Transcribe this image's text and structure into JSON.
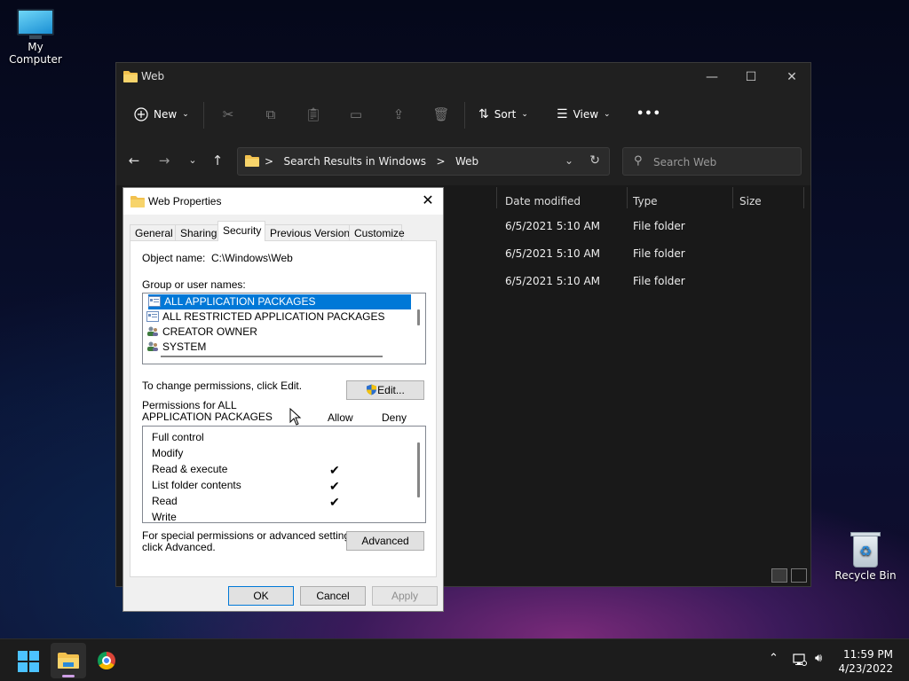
{
  "desktop": {
    "my_computer": "My Computer",
    "recycle_bin": "Recycle Bin"
  },
  "explorer": {
    "title": "Web",
    "toolbar": {
      "new_label": "New",
      "sort_label": "Sort",
      "view_label": "View",
      "more_label": "•••"
    },
    "address": {
      "part1": "Search Results in Windows",
      "part2": "Web",
      "separator": ">"
    },
    "search": {
      "placeholder": "Search Web"
    },
    "columns": {
      "date_modified": "Date modified",
      "type": "Type",
      "size": "Size"
    },
    "rows": [
      {
        "date": "6/5/2021 5:10 AM",
        "type": "File folder"
      },
      {
        "date": "6/5/2021 5:10 AM",
        "type": "File folder"
      },
      {
        "date": "6/5/2021 5:10 AM",
        "type": "File folder"
      }
    ]
  },
  "dialog": {
    "title": "Web Properties",
    "close": "✕",
    "tabs": [
      "General",
      "Sharing",
      "Security",
      "Previous Versions",
      "Customize"
    ],
    "active_tab": "Security",
    "object_name_label": "Object name:",
    "object_name_value": "C:\\Windows\\Web",
    "group_label": "Group or user names:",
    "groups": [
      "ALL APPLICATION PACKAGES",
      "ALL RESTRICTED APPLICATION PACKAGES",
      "CREATOR OWNER",
      "SYSTEM"
    ],
    "selected_group": "ALL APPLICATION PACKAGES",
    "change_text": "To change permissions, click Edit.",
    "edit_button": "Edit...",
    "permissions_label_line1": "Permissions for ALL",
    "permissions_label_line2": "APPLICATION PACKAGES",
    "allow_label": "Allow",
    "deny_label": "Deny",
    "permissions": [
      {
        "name": "Full control",
        "allow": false
      },
      {
        "name": "Modify",
        "allow": false
      },
      {
        "name": "Read & execute",
        "allow": true
      },
      {
        "name": "List folder contents",
        "allow": true
      },
      {
        "name": "Read",
        "allow": true
      },
      {
        "name": "Write",
        "allow": false
      }
    ],
    "check_glyph": "✔",
    "special_text_line1": "For special permissions or advanced settings,",
    "special_text_line2": "click Advanced.",
    "advanced_button": "Advanced",
    "ok_button": "OK",
    "cancel_button": "Cancel",
    "apply_button": "Apply"
  },
  "taskbar": {
    "time": "11:59 PM",
    "date": "4/23/2022"
  },
  "colors": {
    "accent": "#0078d7",
    "folder": "#f2c14e",
    "start": "#4cc2ff"
  }
}
